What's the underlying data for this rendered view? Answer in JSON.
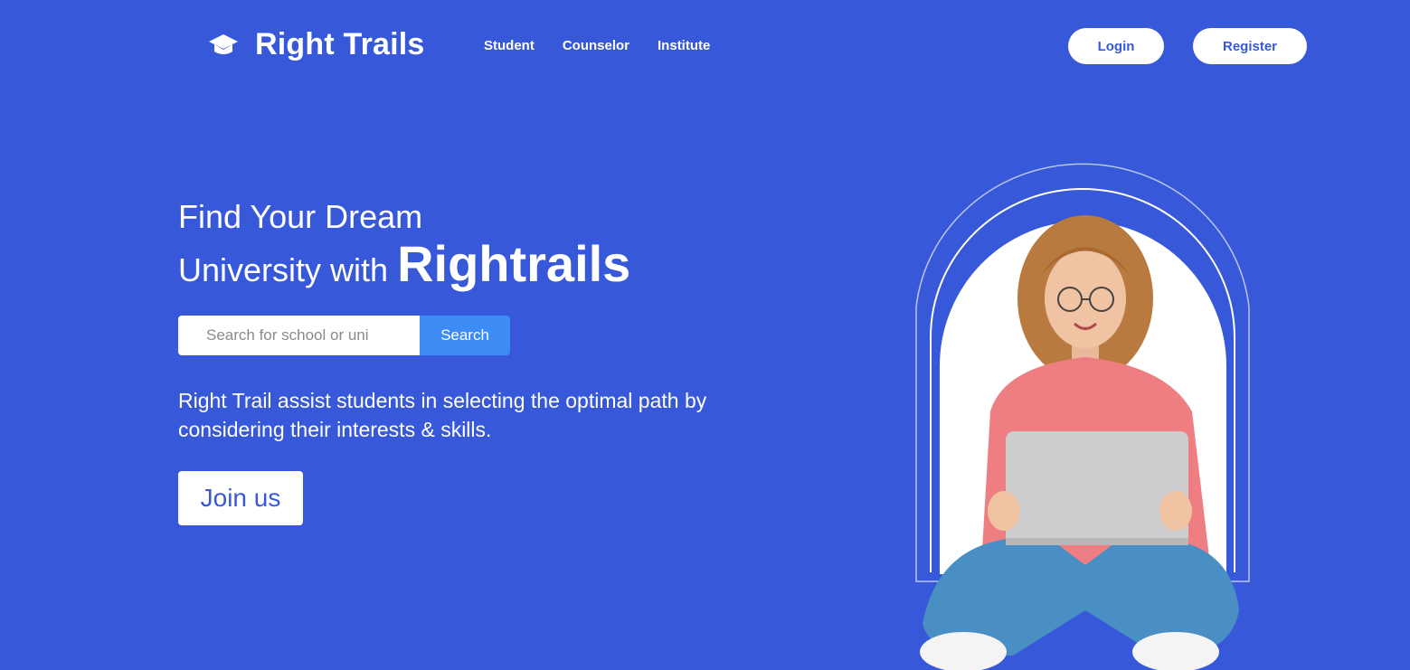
{
  "nav": {
    "brand_name": "Right Trails",
    "links": [
      "Student",
      "Counselor",
      "Institute"
    ],
    "login_label": "Login",
    "register_label": "Register"
  },
  "hero": {
    "title_line1": "Find Your Dream",
    "title_line2_prefix": "University with",
    "title_brand": "Rightrails"
  },
  "search": {
    "placeholder": "Search for school or uni",
    "button_label": "Search"
  },
  "tagline": "Right Trail assist students in selecting the optimal path by considering their interests & skills.",
  "join_label": "Join us",
  "colors": {
    "background": "#3758D9",
    "search_button": "#3D8BF5",
    "text": "#FFFFFF"
  },
  "icons": {
    "brand": "graduation-cap-icon"
  }
}
